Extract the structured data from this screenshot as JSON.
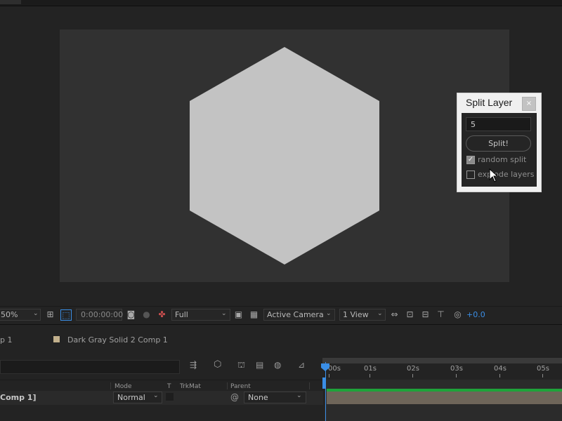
{
  "split_panel": {
    "title": "Split Layer",
    "close_label": "×",
    "count_value": "5",
    "split_button": "Split!",
    "random_split_label": "random split",
    "random_split_checked": true,
    "expand_layers_label": "explode layers",
    "expand_layers_checked": false
  },
  "viewer_toolbar": {
    "zoom": "50%",
    "timecode": "0:00:00:00",
    "resolution": "Full",
    "camera": "Active Camera",
    "views": "1 View",
    "exposure": "+0.0"
  },
  "comp_tabs": {
    "tab1": "p 1",
    "tab2": "Dark Gray Solid 2 Comp 1",
    "tab2_color": "#c2b08c"
  },
  "timeline": {
    "columns": {
      "mode": "Mode",
      "t": "T",
      "trkmat": "TrkMat",
      "parent": "Parent"
    },
    "ticks": [
      "00s",
      "01s",
      "02s",
      "03s",
      "04s",
      "05s"
    ],
    "layer": {
      "name": "Comp 1]",
      "mode": "Normal",
      "parent": "None"
    }
  },
  "colors": {
    "accent": "#3a8ee6",
    "hexagon": "#c3c3c3",
    "track_green": "#1fa33a"
  }
}
